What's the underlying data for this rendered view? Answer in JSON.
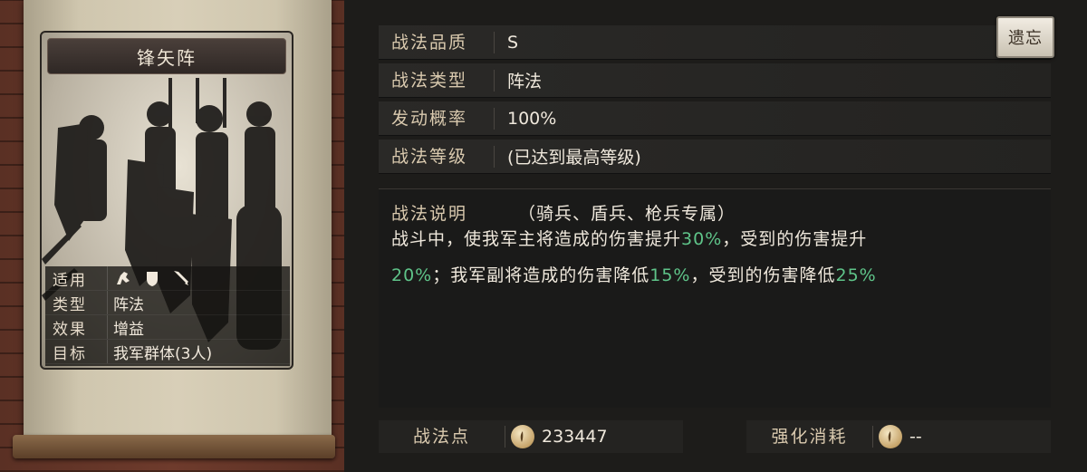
{
  "card": {
    "title": "锋矢阵",
    "info": [
      {
        "label": "适用",
        "value": ""
      },
      {
        "label": "类型",
        "value": "阵法"
      },
      {
        "label": "效果",
        "value": "增益"
      },
      {
        "label": "目标",
        "value": "我军群体(3人)"
      }
    ],
    "unit_icons": [
      "cavalry-icon",
      "shield-icon",
      "spear-icon"
    ]
  },
  "details": {
    "quality_label": "战法品质",
    "quality_value": "S",
    "type_label": "战法类型",
    "type_value": "阵法",
    "rate_label": "发动概率",
    "rate_value": "100%",
    "level_label": "战法等级",
    "level_value": "(已达到最高等级)"
  },
  "description": {
    "label": "战法说明",
    "restriction": "（骑兵、盾兵、枪兵专属）",
    "line1_a": "战斗中，使我军主将造成的伤害提升",
    "line1_b": "30%",
    "line1_c": "，受到的伤害提升",
    "line2_a": "20%",
    "line2_b": "；我军副将造成的伤害降低",
    "line2_c": "15%",
    "line2_d": "，受到的伤害降低",
    "line2_e": "25%"
  },
  "forget_button": "遗忘",
  "points": {
    "label": "战法点",
    "value": "233447"
  },
  "cost": {
    "label": "强化消耗",
    "value": "--"
  },
  "colors": {
    "highlight": "#5fc489",
    "label": "#d9c9ae"
  }
}
